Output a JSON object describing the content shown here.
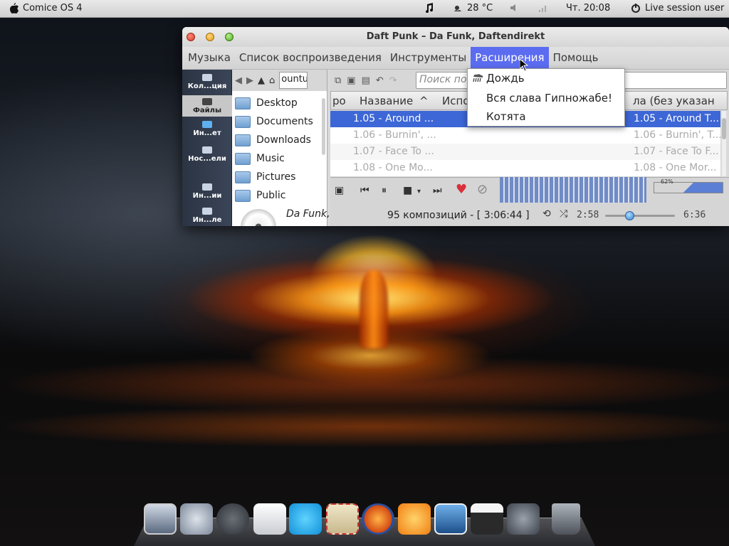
{
  "top_panel": {
    "os_name": "Comice OS 4",
    "weather": "28 °C",
    "clock": "Чт. 20:08",
    "session": "Live session user"
  },
  "window": {
    "title": "Daft Punk – Da Funk, Daftendirekt",
    "menu": [
      "Музыка",
      "Список воспроизведения",
      "Инструменты",
      "Расширения",
      "Помощь"
    ],
    "active_menu": "Расширения"
  },
  "sidebar": {
    "items": [
      {
        "label": "Кол...ция"
      },
      {
        "label": "Файлы",
        "selected": true
      },
      {
        "label": "Ин...ет"
      },
      {
        "label": "Нос...ели"
      },
      {
        "label": "Ин...ии"
      },
      {
        "label": "Ин...ле"
      }
    ]
  },
  "file_browser": {
    "path": "ountu",
    "folders": [
      "Desktop",
      "Documents",
      "Downloads",
      "Music",
      "Pictures",
      "Public"
    ]
  },
  "now_playing": {
    "text": "Da Funk,"
  },
  "playlist": {
    "search_placeholder": "Поиск по",
    "columns": [
      "ро",
      "Название",
      "Испо",
      "ла (без указан"
    ],
    "rows": [
      {
        "title": "1.05 - Around ...",
        "right": "1.05 - Around T...",
        "selected": true
      },
      {
        "title": "1.06 - Burnin', ...",
        "right": "1.06 - Burnin', T..."
      },
      {
        "title": "1.07 - Face To ...",
        "right": "1.07 - Face To F..."
      },
      {
        "title": "1.08 - One Mo...",
        "right": "1.08 - One Mor..."
      }
    ]
  },
  "playback": {
    "volume": "62%",
    "volume_fraction": 0.62,
    "status": "95 композиций - [ 3:06:44 ]",
    "elapsed": "2:58",
    "total": "6:36",
    "seek_fraction": 0.45
  },
  "dropdown": {
    "items": [
      "Дождь",
      "Вся слава Гипножабе!",
      "Котята"
    ]
  },
  "dock": {
    "items": [
      "monitor-icon",
      "rocket-icon",
      "app-store-icon",
      "files-icon",
      "skype-icon",
      "mail-icon",
      "firefox-icon",
      "photos-icon",
      "preview-icon",
      "video-icon",
      "settings-icon",
      "trash-icon"
    ]
  }
}
